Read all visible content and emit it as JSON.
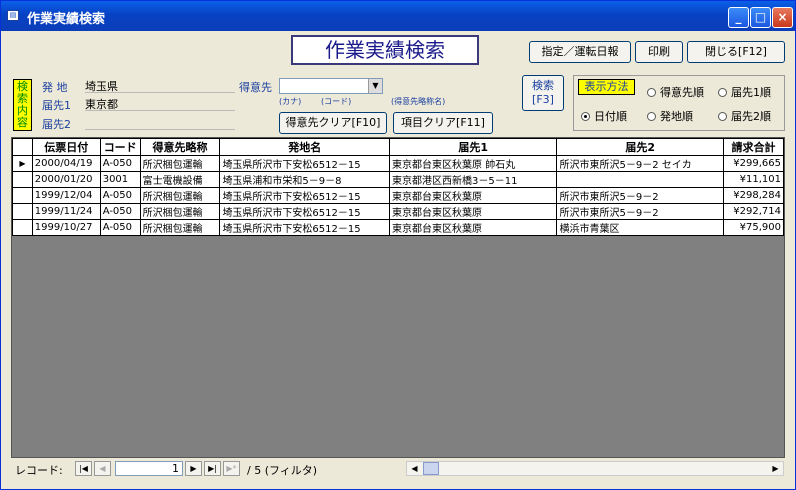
{
  "window": {
    "title": "作業実績検索",
    "min": "_",
    "max": "□",
    "close": "×"
  },
  "header": {
    "title": "作業実績検索"
  },
  "toolbar": {
    "designate_label": "指定／運転日報",
    "print_label": "印刷",
    "close_label": "閉じる[F12]"
  },
  "search": {
    "tag": "検索内容",
    "origin_label": "発 地",
    "origin_value": "埼玉県",
    "dest1_label": "届先1",
    "dest1_value": "東京都",
    "dest2_label": "届先2",
    "dest2_value": "",
    "customer_label": "得意先",
    "customer_value": "",
    "kana_label": "(カナ)",
    "code_label": "(コード)",
    "abbr_label": "(得意先略称名)",
    "clear_customer_label": "得意先クリア[F10]",
    "clear_items_label": "項目クリア[F11]",
    "search_button_label": "検索[F3]"
  },
  "sort": {
    "tag": "表示方法",
    "options": [
      "得意先順",
      "届先1順",
      "日付順",
      "発地順",
      "届先2順"
    ],
    "selected": "日付順"
  },
  "table": {
    "columns": [
      "伝票日付",
      "コード",
      "得意先略称",
      "発地名",
      "届先1",
      "届先2",
      "請求合計"
    ],
    "rows": [
      [
        "2000/04/19",
        "A-050",
        "所沢梱包運輸",
        "埼玉県所沢市下安松6512－15",
        "東京都台東区秋葉原 帥石丸",
        "所沢市東所沢5－9－2 セイカ",
        "¥299,665"
      ],
      [
        "2000/01/20",
        "3001",
        "富士電機設備",
        "埼玉県浦和市栄和5－9－8",
        "東京都港区西新橋3－5－11",
        "",
        "¥11,101"
      ],
      [
        "1999/12/04",
        "A-050",
        "所沢梱包運輸",
        "埼玉県所沢市下安松6512－15",
        "東京都台東区秋葉原",
        "所沢市東所沢5－9－2",
        "¥298,284"
      ],
      [
        "1999/11/24",
        "A-050",
        "所沢梱包運輸",
        "埼玉県所沢市下安松6512－15",
        "東京都台東区秋葉原",
        "所沢市東所沢5－9－2",
        "¥292,714"
      ],
      [
        "1999/10/27",
        "A-050",
        "所沢梱包運輸",
        "埼玉県所沢市下安松6512－15",
        "東京都台東区秋葉原",
        "横浜市青葉区",
        "¥75,900"
      ]
    ],
    "row_selector": "▶"
  },
  "status": {
    "record_label": "レコード:",
    "current": "1",
    "total": "/ 5 (フィルタ)",
    "first": "|◀",
    "prev": "◀",
    "next": "▶",
    "last": "▶|",
    "new": "▶*",
    "scroll_left": "◀",
    "scroll_right": "▶"
  }
}
